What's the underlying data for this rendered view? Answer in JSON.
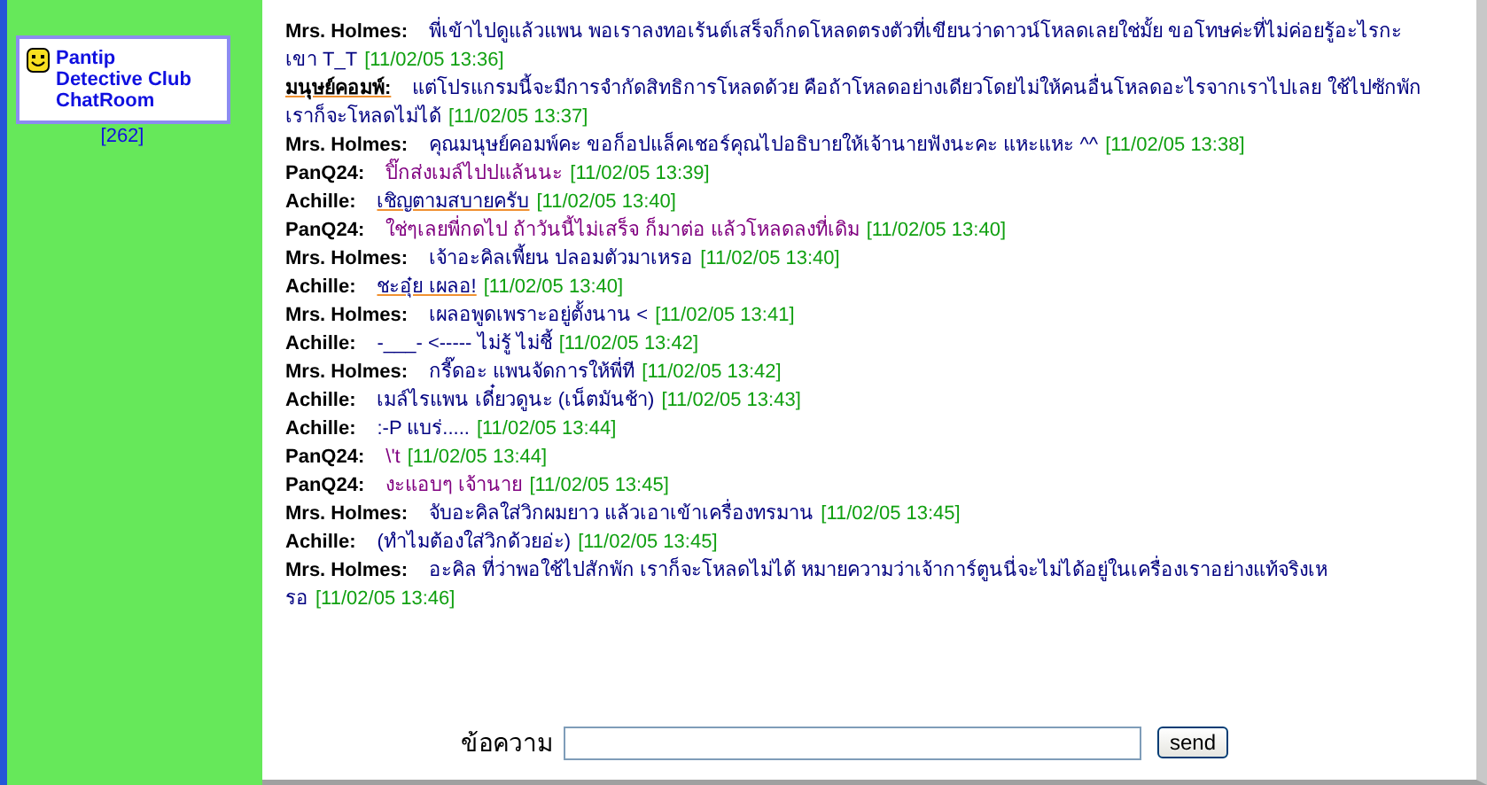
{
  "sidebar": {
    "logo_lines": [
      "Pantip",
      "Detective Club",
      "ChatRoom"
    ],
    "count": "[262]"
  },
  "messages": [
    {
      "name": "Mrs. Holmes:",
      "text": "พี่เข้าไปดูแล้วแพน พอเราลงทอเร้นต์เสร็จก็กดโหลดตรงตัวที่เขียนว่าดาวน์โหลดเลยใช่มั้ย ขอโทษค่ะที่ไม่ค่อยรู้อะไรกะเขา T_T",
      "time": "[11/02/05 13:36]",
      "color": "#000080"
    },
    {
      "name": "มนุษย์คอมพ์:",
      "text": "แต่โปรแกรมนี้จะมีการจำกัดสิทธิการโหลดด้วย คือถ้าโหลดอย่างเดียวโดยไม่ให้คนอื่นโหลดอะไรจากเราไปเลย ใช้ไปซักพักเราก็จะโหลดไม่ได้",
      "time": "[11/02/05 13:37]",
      "color": "#000080",
      "name_underlined": true
    },
    {
      "name": "Mrs. Holmes:",
      "text": "คุณมนุษย์คอมพ์คะ ขอก็อปแล็คเชอร์คุณไปอธิบายให้เจ้านายฟังนะคะ แหะแหะ ^^",
      "time": "[11/02/05 13:38]",
      "color": "#000080"
    },
    {
      "name": "PanQ24:",
      "text": "ปิ๊กส่งเมล์ไปปแล้นนะ",
      "time": "[11/02/05 13:39]",
      "color": "#800080"
    },
    {
      "name": "Achille:",
      "text": "เชิญตามสบายครับ",
      "time": "[11/02/05 13:40]",
      "color": "#000080",
      "text_underlined": true
    },
    {
      "name": "PanQ24:",
      "text": "ใช่ๆเลยพี่กดไป ถ้าวันนี้ไม่เสร็จ ก็มาต่อ แล้วโหลดลงที่เดิม",
      "time": "[11/02/05 13:40]",
      "color": "#800080"
    },
    {
      "name": "Mrs. Holmes:",
      "text": "เจ้าอะคิลเพี้ยน ปลอมตัวมาเหรอ",
      "time": "[11/02/05 13:40]",
      "color": "#000080"
    },
    {
      "name": "Achille:",
      "text": "ชะอุ๋ย เผลอ!",
      "time": "[11/02/05 13:40]",
      "color": "#000080",
      "text_underlined": true
    },
    {
      "name": "Mrs. Holmes:",
      "text": "เผลอพูดเพราะอยู่ตั้งนาน <",
      "time": "[11/02/05 13:41]",
      "color": "#000080"
    },
    {
      "name": "Achille:",
      "text": "-___- <----- ไม่รู้ ไม่ชี้",
      "time": "[11/02/05 13:42]",
      "color": "#000080"
    },
    {
      "name": "Mrs. Holmes:",
      "text": "กรี๊ดอะ แพนจัดการให้พี่ที",
      "time": "[11/02/05 13:42]",
      "color": "#000080"
    },
    {
      "name": "Achille:",
      "text": "เมล์ไรแพน เดี๋ยวดูนะ (เน็ตมันช้า)",
      "time": "[11/02/05 13:43]",
      "color": "#000080"
    },
    {
      "name": "Achille:",
      "text": ":-P แบร่.....",
      "time": "[11/02/05 13:44]",
      "color": "#000080"
    },
    {
      "name": "PanQ24:",
      "text": "\\'t",
      "time": "[11/02/05 13:44]",
      "color": "#800080"
    },
    {
      "name": "PanQ24:",
      "text": "งะแอบๆ เจ้านาย",
      "time": "[11/02/05 13:45]",
      "color": "#800080"
    },
    {
      "name": "Mrs. Holmes:",
      "text": "จับอะคิลใส่วิกผมยาว แล้วเอาเข้าเครื่องทรมาน",
      "time": "[11/02/05 13:45]",
      "color": "#000080"
    },
    {
      "name": "Achille:",
      "text": "(ทำไมต้องใส่วิกด้วยอ่ะ)",
      "time": "[11/02/05 13:45]",
      "color": "#000080"
    },
    {
      "name": "Mrs. Holmes:",
      "text": "อะคิล ที่ว่าพอใช้ไปสักพัก เราก็จะโหลดไม่ได้ หมายความว่าเจ้าการ์ตูนนี่จะไม่ได้อยู่ในเครื่องเราอย่างแท้จริงเหรอ",
      "time": "[11/02/05 13:46]",
      "color": "#000080"
    }
  ],
  "composer": {
    "label": "ข้อความ",
    "button": "send"
  }
}
